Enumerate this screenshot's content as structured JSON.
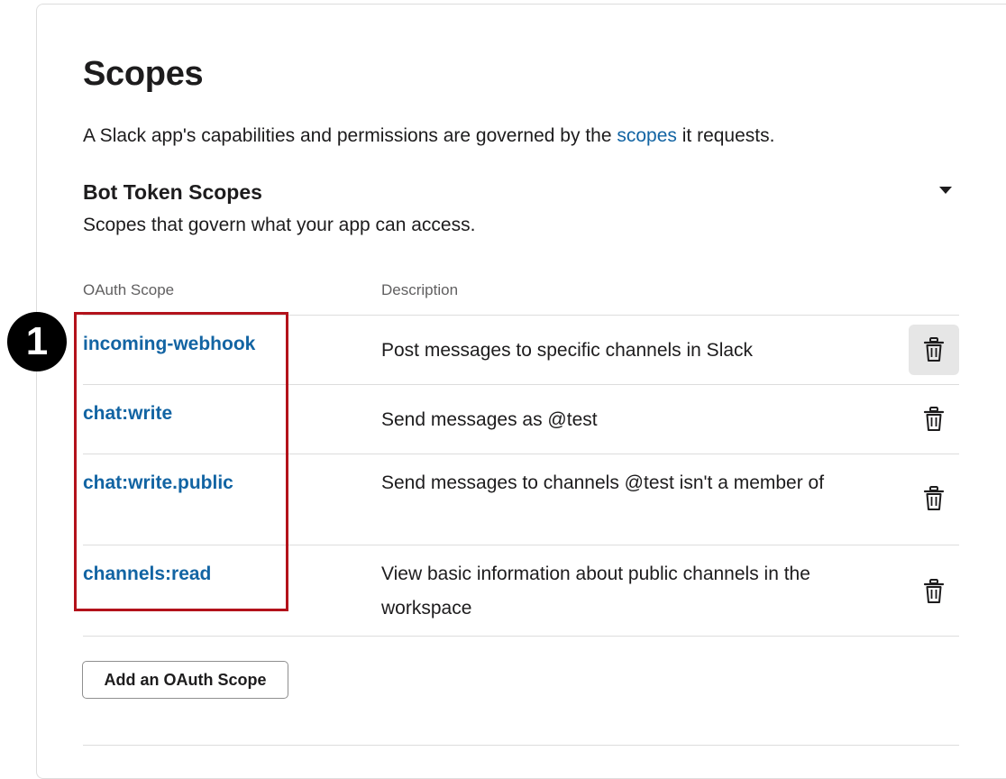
{
  "header": {
    "title": "Scopes",
    "intro_before": "A Slack app's capabilities and permissions are governed by the ",
    "intro_link": "scopes",
    "intro_after": " it requests."
  },
  "section": {
    "title": "Bot Token Scopes",
    "subtitle": "Scopes that govern what your app can access.",
    "expanded": true
  },
  "table": {
    "columns": [
      "OAuth Scope",
      "Description"
    ],
    "rows": [
      {
        "scope": "incoming-webhook",
        "description": "Post messages to specific channels in Slack",
        "delete_icon": "trash-icon"
      },
      {
        "scope": "chat:write",
        "description": "Send messages as @test",
        "delete_icon": "trash-icon"
      },
      {
        "scope": "chat:write.public",
        "description": "Send messages to channels @test isn't a member of",
        "delete_icon": "trash-icon"
      },
      {
        "scope": "channels:read",
        "description": "View basic information about public channels in the workspace",
        "delete_icon": "trash-icon"
      }
    ]
  },
  "actions": {
    "add_scope_label": "Add an OAuth Scope"
  },
  "annotation": {
    "badge_number": "1",
    "highlight_color": "#b3121b"
  },
  "colors": {
    "link": "#1264a3",
    "text": "#1d1c1d",
    "muted": "#616061"
  }
}
